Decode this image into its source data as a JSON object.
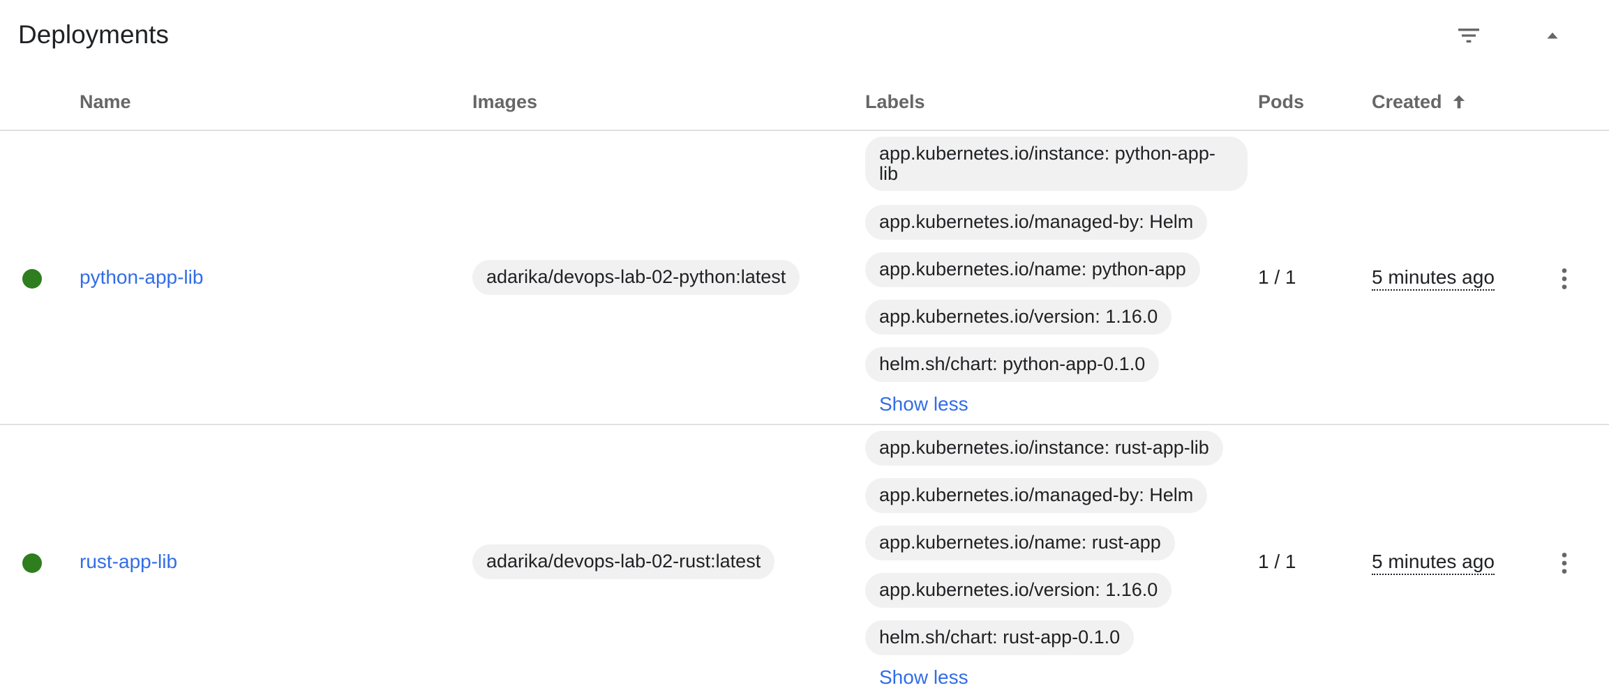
{
  "card": {
    "title": "Deployments"
  },
  "columns": {
    "name": "Name",
    "images": "Images",
    "labels": "Labels",
    "pods": "Pods",
    "created": "Created"
  },
  "colors": {
    "status_ok": "#2e7d1f",
    "link": "#326de6",
    "chip_bg": "#f1f1f1"
  },
  "icons": {
    "filter": "filter-list-icon",
    "collapse": "expand-less-icon",
    "sort": "arrow-upward-icon",
    "status": "status-running-icon",
    "menu": "more-vert-icon"
  },
  "rows": [
    {
      "name": "python-app-lib",
      "image": "adarika/devops-lab-02-python:latest",
      "labels": [
        "app.kubernetes.io/instance: python-app-lib",
        "app.kubernetes.io/managed-by: Helm",
        "app.kubernetes.io/name: python-app",
        "app.kubernetes.io/version: 1.16.0",
        "helm.sh/chart: python-app-0.1.0"
      ],
      "show_less": "Show less",
      "pods": "1 / 1",
      "created": "5 minutes ago"
    },
    {
      "name": "rust-app-lib",
      "image": "adarika/devops-lab-02-rust:latest",
      "labels": [
        "app.kubernetes.io/instance: rust-app-lib",
        "app.kubernetes.io/managed-by: Helm",
        "app.kubernetes.io/name: rust-app",
        "app.kubernetes.io/version: 1.16.0",
        "helm.sh/chart: rust-app-0.1.0"
      ],
      "show_less": "Show less",
      "pods": "1 / 1",
      "created": "5 minutes ago"
    }
  ]
}
